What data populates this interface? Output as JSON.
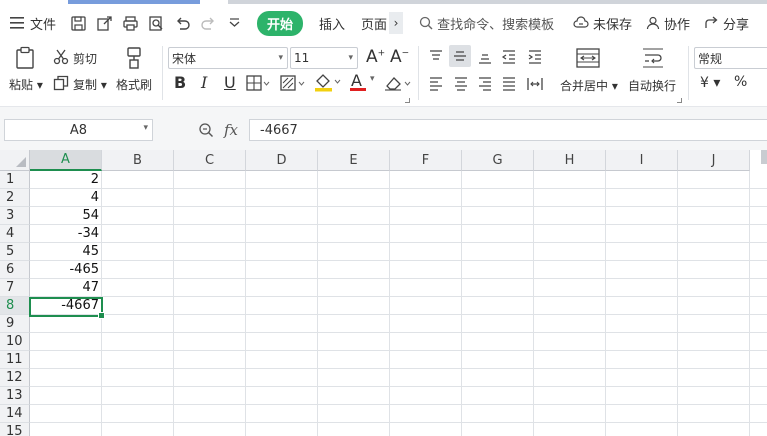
{
  "menu": {
    "file_label": "文件",
    "tab_start": "开始",
    "tab_insert": "插入",
    "tab_page": "页面",
    "search_text": "查找命令、搜索模板",
    "unsaved": "未保存",
    "collab": "协作",
    "share": "分享"
  },
  "ribbon": {
    "paste": "粘贴",
    "cut": "剪切",
    "copy": "复制",
    "format_painter": "格式刷",
    "font_name": "宋体",
    "font_size": "11",
    "bold": "B",
    "italic": "I",
    "underline": "U",
    "font_color_letter": "A",
    "merge_center": "合并居中",
    "wrap_text": "自动换行",
    "number_format": "常规",
    "currency": "¥",
    "percent": "%"
  },
  "formula_bar": {
    "name_box": "A8",
    "fx": "fx",
    "value": "-4667"
  },
  "sheet": {
    "columns": [
      "A",
      "B",
      "C",
      "D",
      "E",
      "F",
      "G",
      "H",
      "I",
      "J"
    ],
    "rows": [
      "1",
      "2",
      "3",
      "4",
      "5",
      "6",
      "7",
      "8",
      "9",
      "10",
      "11",
      "12",
      "13",
      "14",
      "15"
    ],
    "col_a_values": [
      "2",
      "4",
      "54",
      "-34",
      "45",
      "-465",
      "47",
      "-4667"
    ],
    "active_cell": "A8"
  },
  "colors": {
    "accent_green": "#1e8e4f",
    "start_tab": "#2db36a"
  }
}
